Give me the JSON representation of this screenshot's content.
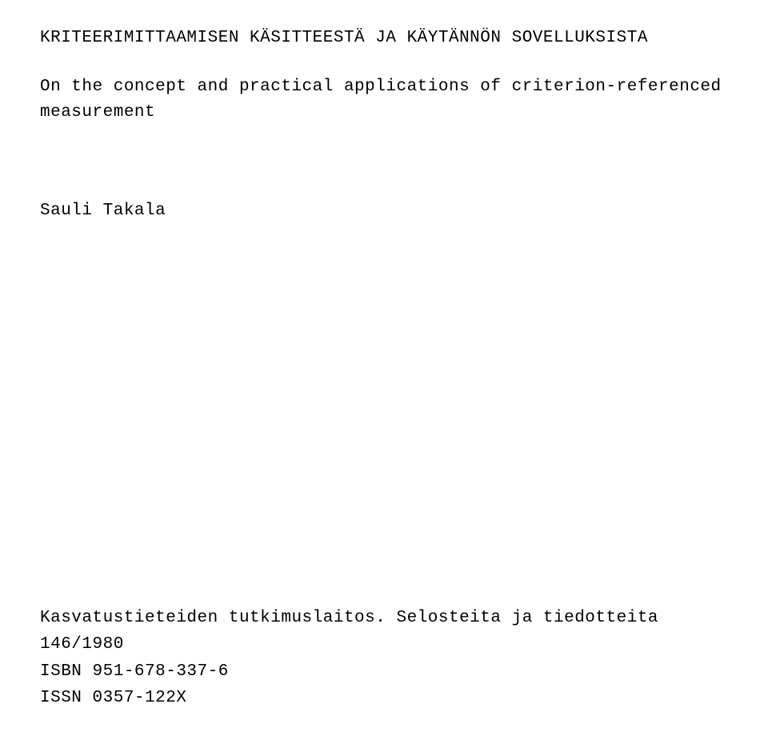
{
  "title": "KRITEERIMITTAAMISEN KÄSITTEESTÄ JA KÄYTÄNNÖN SOVELLUKSISTA",
  "subtitle_line1": "On the concept and practical applications of criterion-referenced",
  "subtitle_line2": "measurement",
  "author": "Sauli Takala",
  "footer": {
    "publisher": "Kasvatustieteiden tutkimuslaitos. Selosteita ja tiedotteita 146/1980",
    "isbn": "ISBN 951-678-337-6",
    "issn": "ISSN 0357-122X"
  }
}
